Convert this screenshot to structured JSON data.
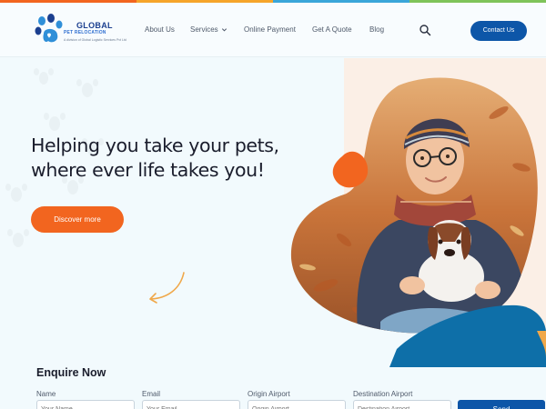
{
  "topbar_colors": [
    "#f2651f",
    "#f6a52b",
    "#3aa6d9",
    "#7fc45a"
  ],
  "logo": {
    "title": "GLOBAL",
    "subtitle": "PET RELOCATION",
    "tagline": "A division of Global Logistic Services Pvt Ltd",
    "icon": "paw-logo-icon",
    "colors": [
      "#1b3f8f",
      "#2f8fd8"
    ]
  },
  "nav": {
    "about": "About Us",
    "services": "Services",
    "payment": "Online Payment",
    "quote": "Get A Quote",
    "blog": "Blog",
    "contact": "Contact Us"
  },
  "hero": {
    "headline_line1": "Helping you take your pets,",
    "headline_line2": "where ever life takes you!",
    "cta": "Discover more",
    "accent_color": "#f2651f",
    "brand_color": "#0d56a8"
  },
  "enquiry": {
    "title": "Enquire Now",
    "fields": [
      {
        "label": "Name",
        "placeholder": "Your Name"
      },
      {
        "label": "Email",
        "placeholder": "Your Email"
      },
      {
        "label": "Origin Airport",
        "placeholder": "Origin Airport"
      },
      {
        "label": "Destination Airport",
        "placeholder": "Destination Airport"
      }
    ],
    "submit": "Send"
  }
}
